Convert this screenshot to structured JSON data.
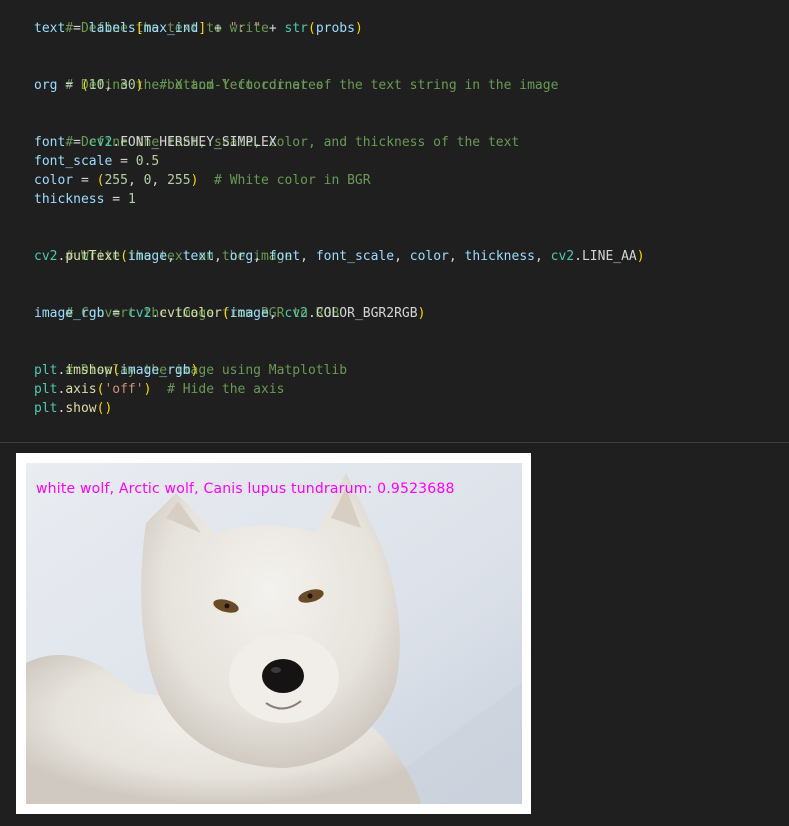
{
  "code": {
    "comment_define_text": "# Define the text to write",
    "text_var": "text",
    "labels_var": "labels",
    "max_ind_var": "max_ind",
    "sep_str": "\": \"",
    "str_fn": "str",
    "probs_var": "probs",
    "comment_org": "# Define the bottom-left corner of the text string in the image",
    "org_var": "org",
    "org_x": "10",
    "org_y": "30",
    "comment_xy": "# X and Y coordinates",
    "comment_font": "# Define the font, scale, color, and thickness of the text",
    "font_var": "font",
    "cv2_mod": "cv2",
    "font_const": "FONT_HERSHEY_SIMPLEX",
    "font_scale_var": "font_scale",
    "font_scale_val": "0.5",
    "color_var": "color",
    "color_r": "255",
    "color_g": "0",
    "color_b": "255",
    "comment_white": "# White color in BGR",
    "thickness_var": "thickness",
    "thickness_val": "1",
    "comment_write": "# Write the text on the image",
    "puttext_fn": "putText",
    "image_var": "image",
    "line_aa_const": "LINE_AA",
    "comment_convert": "# Convert the image from BGR to RGB",
    "image_rgb_var": "image_rgb",
    "cvtcolor_fn": "cvtColor",
    "bgr2rgb_const": "COLOR_BGR2RGB",
    "comment_display": "# Display the image using Matplotlib",
    "plt_mod": "plt",
    "imshow_fn": "imshow",
    "axis_fn": "axis",
    "off_str": "'off'",
    "comment_hide": "# Hide the axis",
    "show_fn": "show"
  },
  "output": {
    "overlay_text": "white wolf, Arctic wolf, Canis lupus tundrarum: 0.9523688",
    "overlay_color": "#ff00ff"
  }
}
